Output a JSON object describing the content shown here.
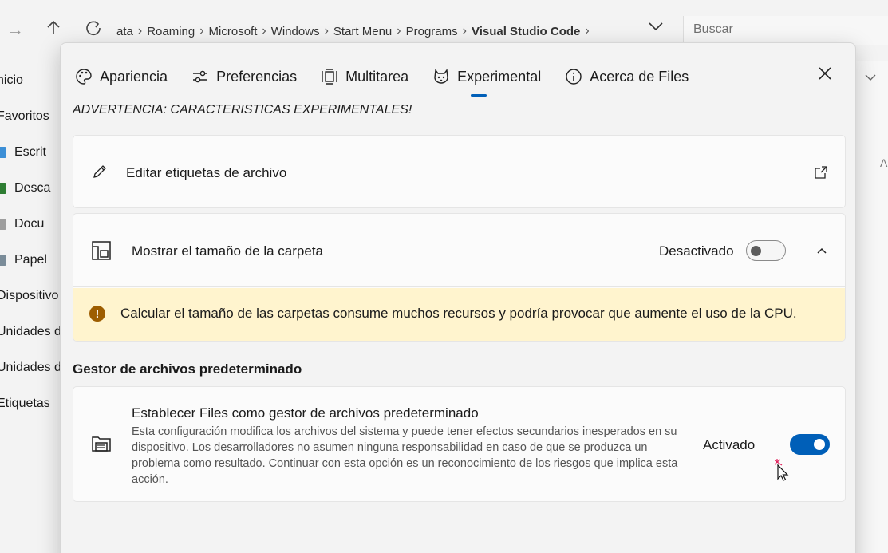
{
  "explorer": {
    "breadcrumb": [
      "ata",
      "Roaming",
      "Microsoft",
      "Windows",
      "Start Menu",
      "Programs",
      "Visual Studio Code"
    ],
    "search_placeholder": "Buscar",
    "sidebar": [
      "nicio",
      "Favoritos",
      "Escrit",
      "Desca",
      "Docu",
      "Papel",
      "Dispositivo",
      "Unidades d",
      "Unidades d",
      "Etiquetas"
    ],
    "right_letter": "A"
  },
  "dialog": {
    "tabs": [
      {
        "label": "Apariencia",
        "icon": "palette-icon"
      },
      {
        "label": "Preferencias",
        "icon": "sliders-icon"
      },
      {
        "label": "Multitarea",
        "icon": "multitask-icon"
      },
      {
        "label": "Experimental",
        "icon": "cat-icon",
        "active": true
      },
      {
        "label": "Acerca de Files",
        "icon": "info-icon"
      }
    ],
    "warning_title": "ADVERTENCIA: CARACTERISTICAS EXPERIMENTALES!",
    "edit_tags": {
      "label": "Editar etiquetas de archivo"
    },
    "folder_size": {
      "label": "Mostrar el tamaño de la carpeta",
      "state": "Desactivado",
      "enabled": false,
      "info": "Calcular el tamaño de las carpetas consume muchos recursos y podría provocar que aumente el uso de la CPU."
    },
    "section_heading": "Gestor de archivos predeterminado",
    "default_manager": {
      "title": "Establecer Files como gestor de archivos predeterminado",
      "description": "Esta configuración modifica los archivos del sistema y puede tener efectos secundarios inesperados en su dispositivo. Los desarrolladores no asumen ninguna responsabilidad en caso de que se produzca un problema como resultado. Continuar con esta opción es un reconocimiento de los riesgos que implica esta acción.",
      "state": "Activado",
      "enabled": true
    }
  },
  "colors": {
    "accent": "#005fb8",
    "info_bar": "#fff4ce",
    "info_icon": "#9d5d00"
  }
}
